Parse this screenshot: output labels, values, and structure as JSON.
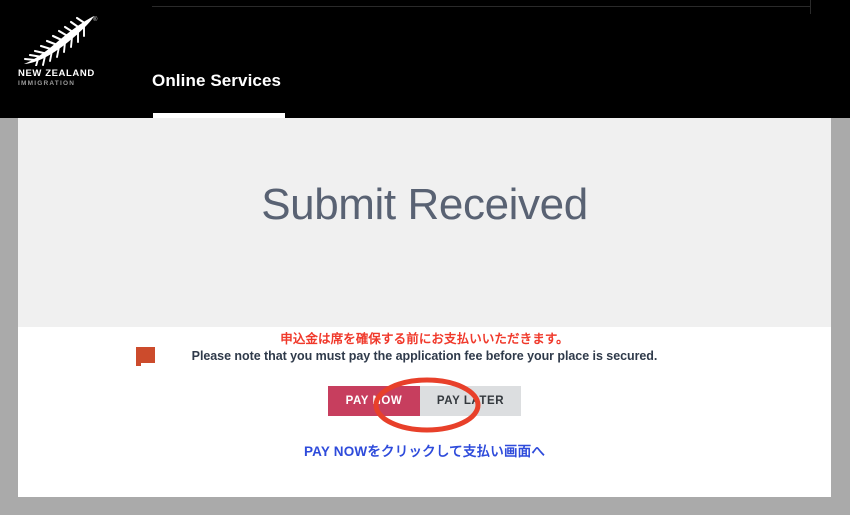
{
  "header": {
    "logo": {
      "icon": "silver-fern-icon",
      "name": "NEW ZEALAND",
      "subtitle": "IMMIGRATION",
      "registered_mark": "®"
    },
    "title": "Online Services",
    "background_color": "#000000",
    "active_tab_indicator_color": "#ffffff"
  },
  "hero": {
    "title": "Submit Received",
    "background_color": "#f0f0f0",
    "title_color": "#596273"
  },
  "notice": {
    "icon": "speech-bubble-icon",
    "icon_color": "#cc4b2c",
    "japanese_text": "申込金は席を確保する前にお支払いいただきます。",
    "japanese_color": "#f0392b",
    "english_text": "Please note that you must pay the application fee before your place is secured.",
    "english_color": "#2f3a4a"
  },
  "actions": {
    "pay_now_label": "PAY NOW",
    "pay_now_color": "#c73e5e",
    "pay_later_label": "PAY LATER",
    "pay_later_color": "#dcdee0"
  },
  "annotation": {
    "shape": "ellipse-highlight",
    "target": "PAY NOW",
    "stroke_color": "#e8402a"
  },
  "footer_link": {
    "text": "PAY NOWをクリックして支払い画面へ",
    "color": "#2e4bdb"
  },
  "page": {
    "content_background": "#ffffff",
    "browser_chrome_color": "#aaaaaa"
  }
}
